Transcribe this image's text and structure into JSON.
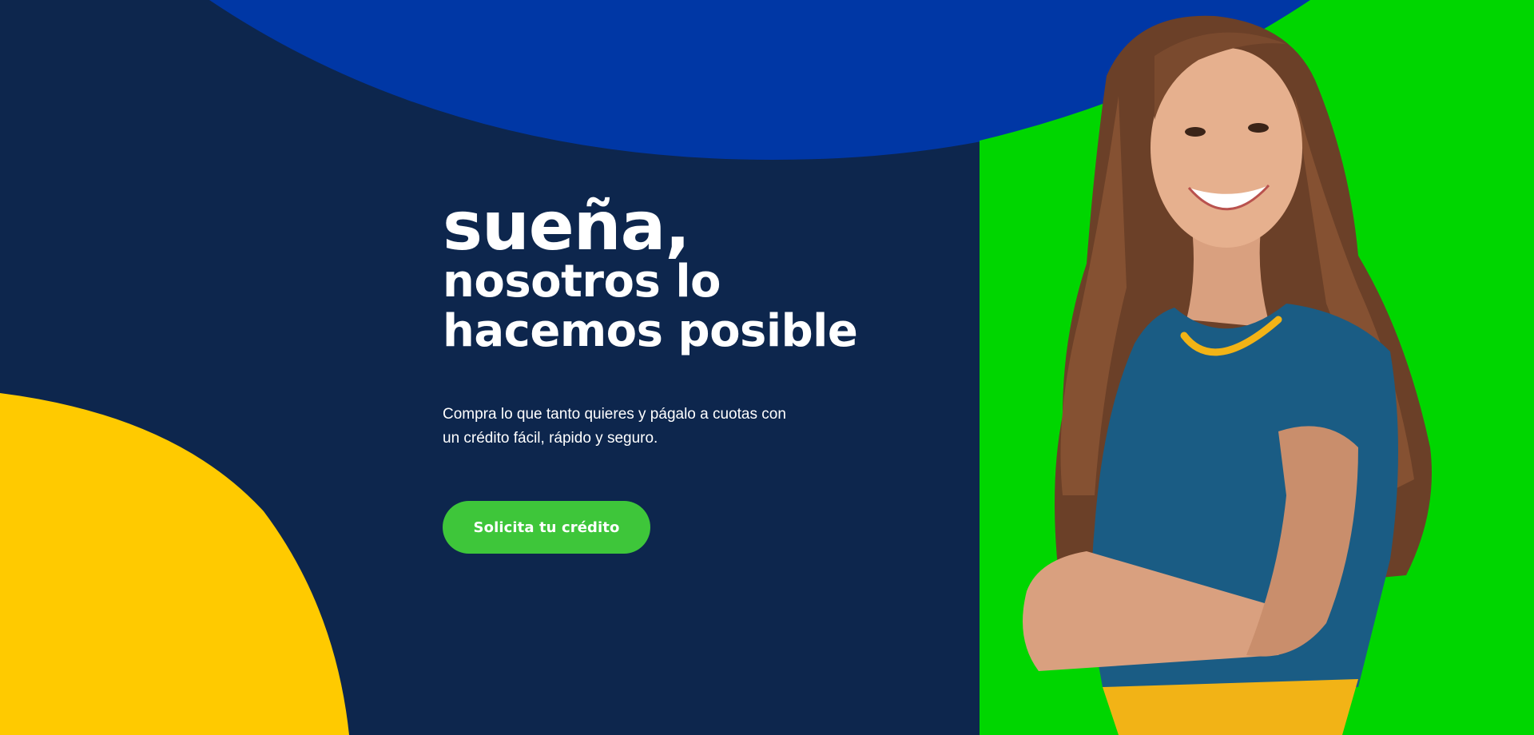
{
  "hero": {
    "headline_line1": "sueña,",
    "headline_line2": "nosotros lo hacemos posible",
    "subtitle": "Compra lo que tanto quieres y págalo a cuotas con un crédito fácil, rápido y seguro.",
    "cta_label": "Solicita tu crédito"
  },
  "colors": {
    "background": "#0d264d",
    "top_blob": "#0037a5",
    "bottom_left_blob": "#ffca00",
    "photo_panel": "#00d600",
    "cta": "#3ec63a",
    "text": "#ffffff"
  },
  "image": {
    "subject": "smiling-woman-photo"
  }
}
